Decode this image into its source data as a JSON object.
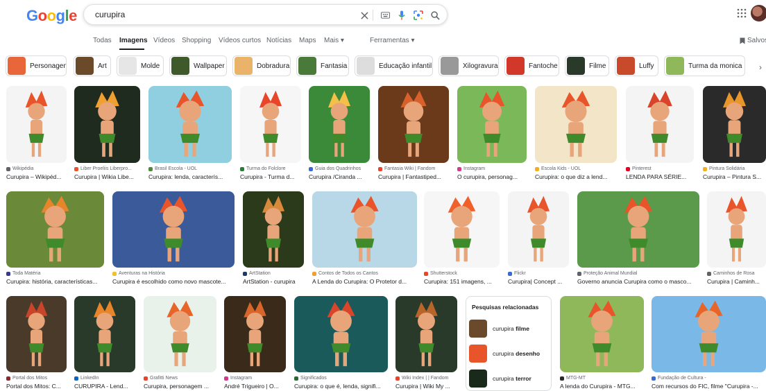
{
  "header": {
    "logo_letters": [
      {
        "ch": "G",
        "color": "#4285F4"
      },
      {
        "ch": "o",
        "color": "#EA4335"
      },
      {
        "ch": "o",
        "color": "#FBBC05"
      },
      {
        "ch": "g",
        "color": "#4285F4"
      },
      {
        "ch": "l",
        "color": "#34A853"
      },
      {
        "ch": "e",
        "color": "#EA4335"
      }
    ],
    "query": "curupira"
  },
  "tabs": {
    "todas": "Todas",
    "imagens": "Imagens",
    "videos": "Vídeos",
    "shopping": "Shopping",
    "videos_curtos": "Vídeos curtos",
    "noticias": "Notícias",
    "maps": "Maps",
    "mais": "Mais ▾",
    "ferramentas": "Ferramentas ▾",
    "salvos": "Salvos"
  },
  "chips": [
    {
      "label": "Personagem",
      "color": "#e8663a"
    },
    {
      "label": "Art",
      "color": "#6b4a2a"
    },
    {
      "label": "Molde",
      "color": "#e6e6e6"
    },
    {
      "label": "Wallpaper",
      "color": "#3f5a2a"
    },
    {
      "label": "Dobradura",
      "color": "#e9b46a"
    },
    {
      "label": "Fantasia",
      "color": "#4a7a3a"
    },
    {
      "label": "Educação infantil",
      "color": "#dddddd"
    },
    {
      "label": "Xilogravura",
      "color": "#999999"
    },
    {
      "label": "Fantoche",
      "color": "#d2382a"
    },
    {
      "label": "Filme",
      "color": "#2a3a2a"
    },
    {
      "label": "Luffy",
      "color": "#c94a2a"
    },
    {
      "label": "Turma da monica",
      "color": "#8fb85a"
    }
  ],
  "row1": [
    {
      "source": "Wikipédia",
      "title": "Curupira – Wikipéd...",
      "bg": "#f4f4f4",
      "fg": "#e8552a",
      "fav": "#5f6368"
    },
    {
      "source": "Liber Proeliis Liberpro...",
      "title": "Curupira | Wikia Libe...",
      "bg": "#1f2b1f",
      "fg": "#f0a030",
      "fav": "#e8552a"
    },
    {
      "source": "Brasil Escola - UOL",
      "title": "Curupira: lenda, caracterís...",
      "bg": "#8fcfe0",
      "fg": "#e8552a",
      "fav": "#4a8a3a"
    },
    {
      "source": "Turma do Folclore",
      "title": "Curupira - Turma d...",
      "bg": "#f6f6f6",
      "fg": "#e8452a",
      "fav": "#2a7a3a"
    },
    {
      "source": "Guia dos Quadrinhos",
      "title": "Curupira /Ciranda ...",
      "bg": "#3a8a3a",
      "fg": "#f5c04a",
      "fav": "#3a6ad0"
    },
    {
      "source": "Fantasia Wiki | Fandom",
      "title": "Curupira | Fantastiped...",
      "bg": "#6a3a1a",
      "fg": "#d8602a",
      "fav": "#e8452a"
    },
    {
      "source": "Instagram",
      "title": "O curupira, personag...",
      "bg": "#7ab85a",
      "fg": "#e8552a",
      "fav": "#d63a8a"
    },
    {
      "source": "Escola Kids - UOL",
      "title": "Curupira: o que diz a lend...",
      "bg": "#f3e6c8",
      "fg": "#e8552a",
      "fav": "#f0b020"
    },
    {
      "source": "Pinterest",
      "title": "LENDA PARA SÉRIE...",
      "bg": "#f4f4f4",
      "fg": "#d8452a",
      "fav": "#e60023"
    },
    {
      "source": "Pintura Solidária",
      "title": "Curupira – Pintura S...",
      "bg": "#2a2a2a",
      "fg": "#e8952a",
      "fav": "#f0b020"
    }
  ],
  "row2": [
    {
      "source": "Toda Matéria",
      "title": "Curupira: história, características...",
      "bg": "#6a8a3a",
      "fg": "#e8852a",
      "fav": "#3a3a8a"
    },
    {
      "source": "Aventuras na História",
      "title": "Curupira é escolhido como novo mascote...",
      "bg": "#3a5a9a",
      "fg": "#e8552a",
      "fav": "#f0c030"
    },
    {
      "source": "ArtStation",
      "title": "ArtStation - curupira",
      "bg": "#2a3a1a",
      "fg": "#d88a3a",
      "fav": "#1a3a6a"
    },
    {
      "source": "Contos de Todos os Cantos",
      "title": "A Lenda do Curupira: O Protetor d...",
      "bg": "#b8d8e8",
      "fg": "#e8552a",
      "fav": "#f0a030"
    },
    {
      "source": "Shutterstock",
      "title": "Curupira: 151 imagens, ...",
      "bg": "#f6f6f6",
      "fg": "#f0602a",
      "fav": "#e8452a"
    },
    {
      "source": "Flickr",
      "title": "Curupira| Concept ...",
      "bg": "#f4f4f4",
      "fg": "#e8552a",
      "fav": "#3a6ad0"
    },
    {
      "source": "Proteção Animal Mundial",
      "title": "Governo anuncia Curupira como o masco...",
      "bg": "#5a9a4a",
      "fg": "#e8552a",
      "fav": "#5f6368"
    },
    {
      "source": "Caminhos de Rosa",
      "title": "Curupira | Caminh...",
      "bg": "#f4f4f4",
      "fg": "#e8552a",
      "fav": "#5f6368"
    }
  ],
  "row3": [
    {
      "source": "Portal dos Mitos",
      "title": "Portal dos Mitos: C...",
      "bg": "#4a3a2a",
      "fg": "#c8452a",
      "fav": "#8a2a2a"
    },
    {
      "source": "LinkedIn",
      "title": "CURUPIRA - Lend...",
      "bg": "#2a3a2a",
      "fg": "#e8852a",
      "fav": "#0a66c2"
    },
    {
      "source": "Grafitti News",
      "title": "Curupira, personagem ...",
      "bg": "#e8f2ea",
      "fg": "#e8652a",
      "fav": "#e8452a"
    },
    {
      "source": "Instagram",
      "title": "André Trigueiro | O...",
      "bg": "#3a2a1a",
      "fg": "#d8652a",
      "fav": "#d63a8a"
    },
    {
      "source": "Significados",
      "title": "Curupira: o que é, lenda, signifi...",
      "bg": "#1a5a5a",
      "fg": "#d8452a",
      "fav": "#2a6a3a"
    },
    {
      "source": "Wiki Index | | Fandom",
      "title": "Curupira | Wiki My ...",
      "bg": "#2a3a2a",
      "fg": "#b8652a",
      "fav": "#e8452a"
    },
    {
      "source": "MTG-MT",
      "title": "A lenda do Curupira - MTG...",
      "bg": "#8fb85a",
      "fg": "#e8552a",
      "fav": "#2a2a2a"
    },
    {
      "source": "Fundação de Cultura -",
      "title": "Com recursos do FIC, filme \"Curupira -...",
      "bg": "#7ab8e8",
      "fg": "#e8652a",
      "fav": "#3a6ad0"
    }
  ],
  "related": {
    "header": "Pesquisas relacionadas",
    "items": [
      {
        "prefix": "curupira ",
        "bold": "filme",
        "color": "#6a4a2a"
      },
      {
        "prefix": "curupira ",
        "bold": "desenho",
        "color": "#e8552a"
      },
      {
        "prefix": "curupira ",
        "bold": "terror",
        "color": "#1a2a1a"
      }
    ]
  }
}
